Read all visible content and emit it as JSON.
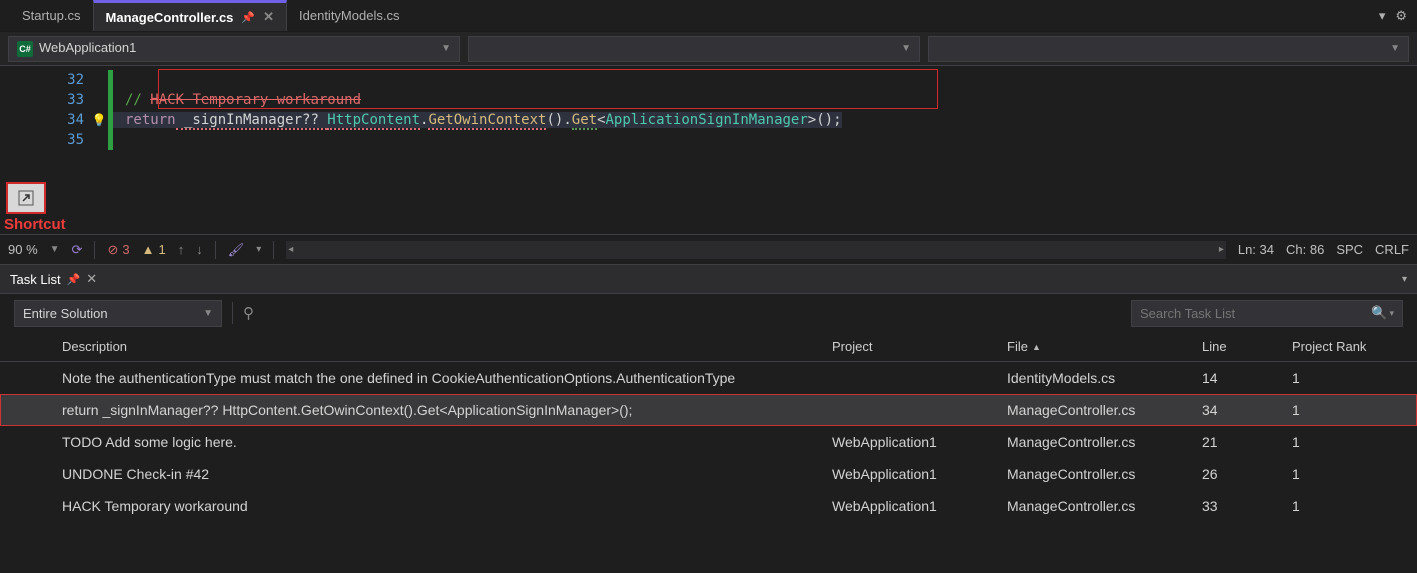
{
  "tabs": [
    {
      "label": "Startup.cs"
    },
    {
      "label": "ManageController.cs"
    },
    {
      "label": "IdentityModels.cs"
    }
  ],
  "nav": {
    "scope": "WebApplication1"
  },
  "code": {
    "ln32": "32",
    "ln33": "33",
    "ln34": "34",
    "ln35": "35",
    "comment_prefix": "// ",
    "comment_hack": "HACK Temporary workaround",
    "kw_return": "return",
    "ident": " _signInManager?? ",
    "type_httpcontent": "HttpContent",
    "dot1": ".",
    "m_getowin": "GetOwinContext",
    "call1": "().",
    "m_get": "Get",
    "lt": "<",
    "type_app": "ApplicationSignInManager",
    "gt": ">",
    "tail": "();"
  },
  "annotation": {
    "label": "Shortcut"
  },
  "status": {
    "zoom": "90 %",
    "errors": "3",
    "warnings": "1",
    "ln": "Ln: 34",
    "ch": "Ch: 86",
    "spc": "SPC",
    "eol": "CRLF"
  },
  "task_panel": {
    "title": "Task List",
    "scope": "Entire Solution",
    "search_placeholder": "Search Task List"
  },
  "columns": {
    "description": "Description",
    "project": "Project",
    "file": "File",
    "line": "Line",
    "rank": "Project Rank"
  },
  "tasks": [
    {
      "desc": "Note the authenticationType must match the one defined in CookieAuthenticationOptions.AuthenticationType",
      "project": "",
      "file": "IdentityModels.cs",
      "line": "14",
      "rank": "1"
    },
    {
      "desc": "return _signInManager?? HttpContent.GetOwinContext().Get<ApplicationSignInManager>();",
      "project": "",
      "file": "ManageController.cs",
      "line": "34",
      "rank": "1"
    },
    {
      "desc": "TODO Add some logic here.",
      "project": "WebApplication1",
      "file": "ManageController.cs",
      "line": "21",
      "rank": "1"
    },
    {
      "desc": "UNDONE Check-in #42",
      "project": "WebApplication1",
      "file": "ManageController.cs",
      "line": "26",
      "rank": "1"
    },
    {
      "desc": "HACK Temporary workaround",
      "project": "WebApplication1",
      "file": "ManageController.cs",
      "line": "33",
      "rank": "1"
    }
  ]
}
